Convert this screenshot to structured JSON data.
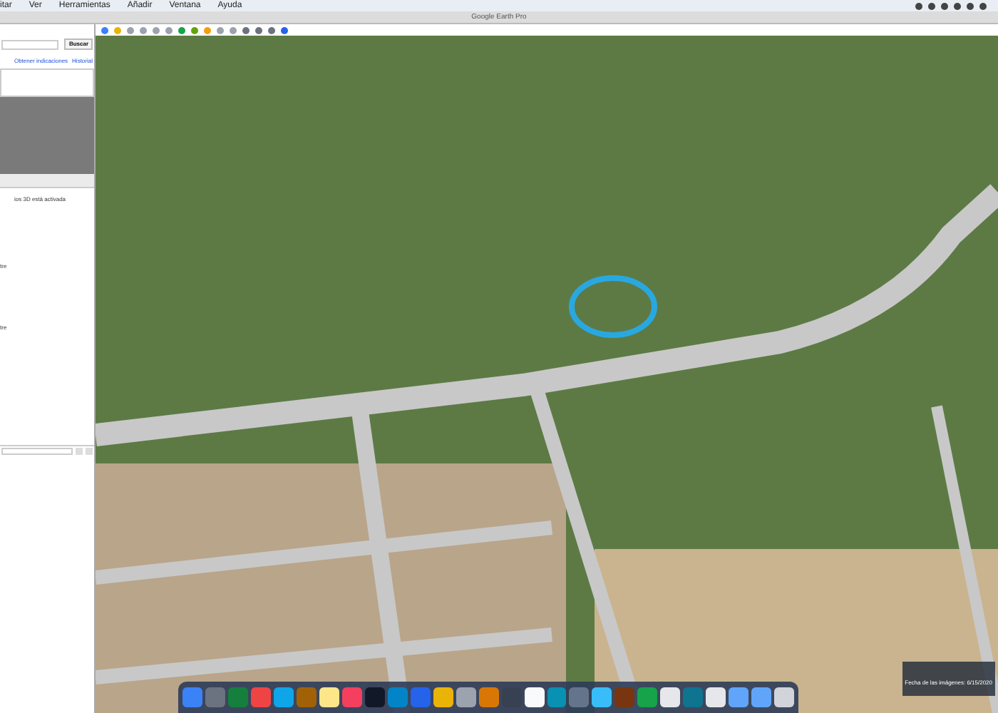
{
  "menu_bar": {
    "items": [
      "itar",
      "Ver",
      "Herramientas",
      "Añadir",
      "Ventana",
      "Ayuda"
    ]
  },
  "window": {
    "title": "Google Earth Pro"
  },
  "sidebar": {
    "search_button": "Buscar",
    "links": [
      "Obtener indicaciones",
      "Historial"
    ],
    "layers_lines": [
      "ios 3D está activada",
      "tre",
      "tre"
    ]
  },
  "status_bar": {
    "image_date": "Fecha de las imágenes: 6/15/2020"
  }
}
